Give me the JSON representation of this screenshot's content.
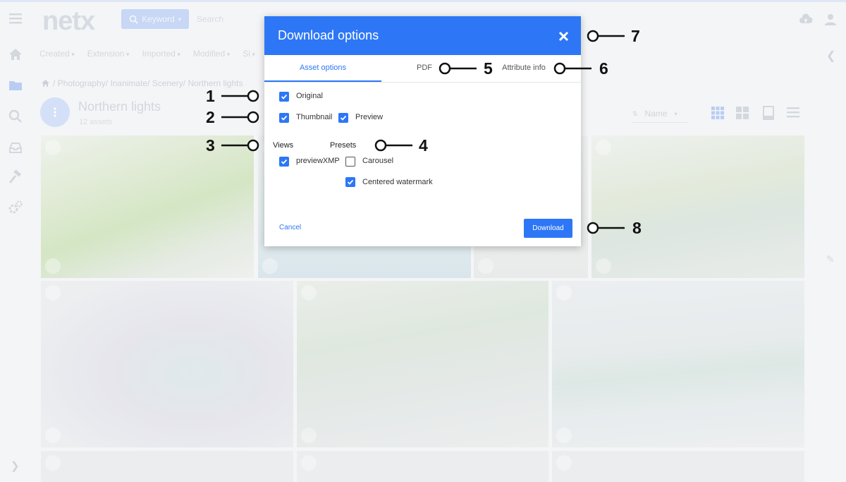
{
  "app": {
    "logo": "netx"
  },
  "header": {
    "keyword_label": "Keyword",
    "search_placeholder": "Search"
  },
  "filters": [
    "Created",
    "Extension",
    "Imported",
    "Modified",
    "Si"
  ],
  "breadcrumb": "/ Photography/ Inanimate/ Scenery/ Northern lights",
  "folder": {
    "title": "Northern lights",
    "count": "12 assets"
  },
  "sort": {
    "label": "Name"
  },
  "modal": {
    "title": "Download options",
    "tabs": [
      {
        "label": "Asset options",
        "active": true
      },
      {
        "label": "PDF",
        "active": false
      },
      {
        "label": "Attribute info",
        "active": false
      }
    ],
    "options": {
      "original": {
        "label": "Original",
        "checked": true
      },
      "thumbnail": {
        "label": "Thumbnail",
        "checked": true
      },
      "preview": {
        "label": "Preview",
        "checked": true
      }
    },
    "views": {
      "heading": "Views",
      "items": [
        {
          "label": "previewXMP",
          "checked": true
        }
      ]
    },
    "presets": {
      "heading": "Presets",
      "items": [
        {
          "label": "Carousel",
          "checked": false
        },
        {
          "label": "Centered watermark",
          "checked": true
        }
      ]
    },
    "cancel_label": "Cancel",
    "download_label": "Download"
  },
  "callouts": [
    "1",
    "2",
    "3",
    "4",
    "5",
    "6",
    "7",
    "8"
  ],
  "colors": {
    "accent": "#2d77f6",
    "overlay_bg": "#f4f5f7"
  }
}
